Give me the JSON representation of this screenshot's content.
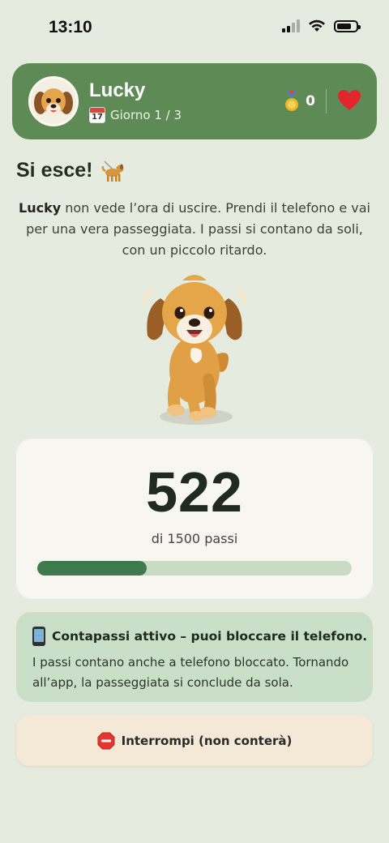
{
  "status_bar": {
    "time": "13:10"
  },
  "header": {
    "pet_name": "Lucky",
    "day_label": "Giorno 1 / 3",
    "calendar_day": "17",
    "medal_count": "0"
  },
  "walk": {
    "title": "Si esce!",
    "intro_name": "Lucky",
    "intro_text": " non vede l’ora di uscire. Prendi il telefono e vai per una vera passeggiata. I passi si contano da soli, con un piccolo ritardo.",
    "steps": "522",
    "steps_total_label": "di 1500 passi",
    "progress_fraction": 0.348
  },
  "info": {
    "title": "Contapassi attivo – puoi bloccare il telefono.",
    "text": "I passi contano anche a telefono bloccato. Tornando all’app, la passeggiata si conclude da sola."
  },
  "actions": {
    "stop_label": "Interrompi (non conterà)"
  },
  "colors": {
    "background": "#e6ebdf",
    "header": "#5e8a56",
    "progress_fill": "#3e7a4c",
    "progress_track": "#c9dcc3",
    "info_card": "#cadfc7",
    "stop_button": "#f4e8d6"
  }
}
